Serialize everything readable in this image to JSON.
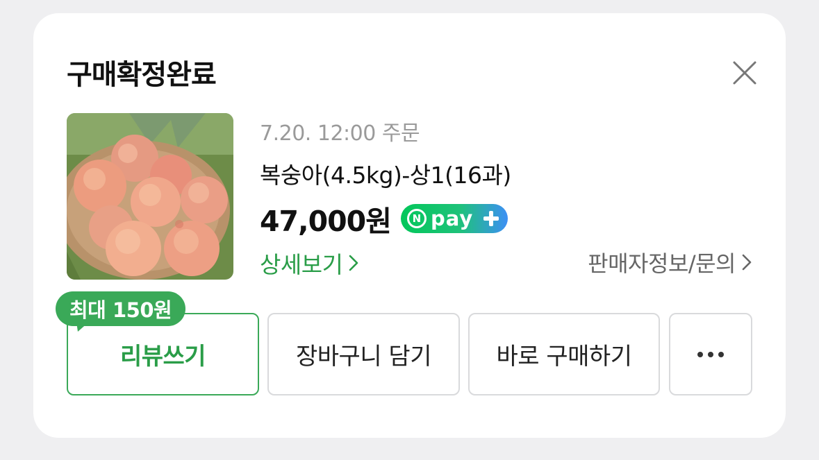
{
  "header": {
    "title": "구매확정완료"
  },
  "order": {
    "meta": "7.20. 12:00 주문",
    "product_name": "복숭아(4.5kg)-상1(16과)",
    "price": "47,000원",
    "npay": {
      "n": "N",
      "word": "pay"
    }
  },
  "links": {
    "detail": "상세보기",
    "seller": "판매자정보/문의"
  },
  "badge": {
    "label": "최대 150원"
  },
  "buttons": {
    "review": "리뷰쓰기",
    "cart": "장바구니 담기",
    "buy": "바로 구매하기"
  },
  "colors": {
    "accent_green": "#3aa958",
    "link_green": "#2a9d48",
    "npay_blue": "#3d8ff5"
  },
  "icons": [
    "close-icon",
    "chevron-right-icon",
    "more-dots-icon",
    "npay-plus-icon"
  ]
}
